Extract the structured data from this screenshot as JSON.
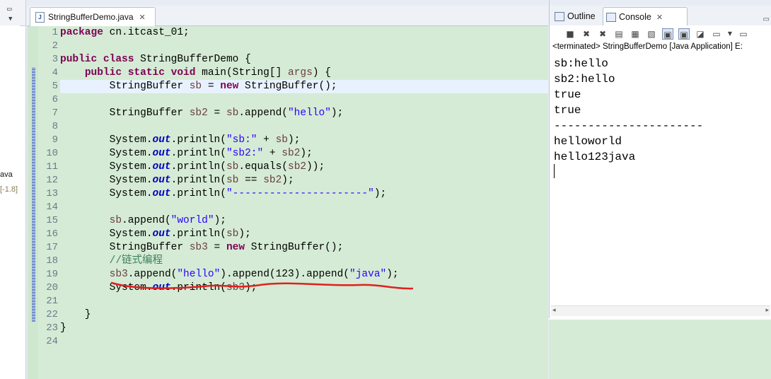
{
  "editor": {
    "tab_title": "StringBufferDemo.java",
    "lines": [
      {
        "n": "1",
        "segs": [
          {
            "t": "package",
            "c": "kw"
          },
          {
            "t": " cn.itcast_01;",
            "c": ""
          }
        ]
      },
      {
        "n": "2",
        "segs": []
      },
      {
        "n": "3",
        "segs": [
          {
            "t": "public",
            "c": "kw"
          },
          {
            "t": " ",
            "c": ""
          },
          {
            "t": "class",
            "c": "kw"
          },
          {
            "t": " StringBufferDemo {",
            "c": ""
          }
        ]
      },
      {
        "n": "4",
        "segs": [
          {
            "t": "    ",
            "c": ""
          },
          {
            "t": "public",
            "c": "kw"
          },
          {
            "t": " ",
            "c": ""
          },
          {
            "t": "static",
            "c": "kw"
          },
          {
            "t": " ",
            "c": ""
          },
          {
            "t": "void",
            "c": "kw"
          },
          {
            "t": " main(String[] ",
            "c": ""
          },
          {
            "t": "args",
            "c": "var"
          },
          {
            "t": ") {",
            "c": ""
          }
        ]
      },
      {
        "n": "5",
        "segs": [
          {
            "t": "        StringBuffer ",
            "c": ""
          },
          {
            "t": "sb",
            "c": "var"
          },
          {
            "t": " = ",
            "c": ""
          },
          {
            "t": "new",
            "c": "kw"
          },
          {
            "t": " StringBuffer();",
            "c": ""
          }
        ]
      },
      {
        "n": "6",
        "segs": []
      },
      {
        "n": "7",
        "segs": [
          {
            "t": "        StringBuffer ",
            "c": ""
          },
          {
            "t": "sb2",
            "c": "var"
          },
          {
            "t": " = ",
            "c": ""
          },
          {
            "t": "sb",
            "c": "var"
          },
          {
            "t": ".append(",
            "c": ""
          },
          {
            "t": "\"hello\"",
            "c": "str"
          },
          {
            "t": ");",
            "c": ""
          }
        ]
      },
      {
        "n": "8",
        "segs": []
      },
      {
        "n": "9",
        "segs": [
          {
            "t": "        System.",
            "c": ""
          },
          {
            "t": "out",
            "c": "fld"
          },
          {
            "t": ".println(",
            "c": ""
          },
          {
            "t": "\"sb:\"",
            "c": "str"
          },
          {
            "t": " + ",
            "c": ""
          },
          {
            "t": "sb",
            "c": "var"
          },
          {
            "t": ");",
            "c": ""
          }
        ]
      },
      {
        "n": "10",
        "segs": [
          {
            "t": "        System.",
            "c": ""
          },
          {
            "t": "out",
            "c": "fld"
          },
          {
            "t": ".println(",
            "c": ""
          },
          {
            "t": "\"sb2:\"",
            "c": "str"
          },
          {
            "t": " + ",
            "c": ""
          },
          {
            "t": "sb2",
            "c": "var"
          },
          {
            "t": ");",
            "c": ""
          }
        ]
      },
      {
        "n": "11",
        "segs": [
          {
            "t": "        System.",
            "c": ""
          },
          {
            "t": "out",
            "c": "fld"
          },
          {
            "t": ".println(",
            "c": ""
          },
          {
            "t": "sb",
            "c": "var"
          },
          {
            "t": ".equals(",
            "c": ""
          },
          {
            "t": "sb2",
            "c": "var"
          },
          {
            "t": "));",
            "c": ""
          }
        ]
      },
      {
        "n": "12",
        "segs": [
          {
            "t": "        System.",
            "c": ""
          },
          {
            "t": "out",
            "c": "fld"
          },
          {
            "t": ".println(",
            "c": ""
          },
          {
            "t": "sb",
            "c": "var"
          },
          {
            "t": " == ",
            "c": ""
          },
          {
            "t": "sb2",
            "c": "var"
          },
          {
            "t": ");",
            "c": ""
          }
        ]
      },
      {
        "n": "13",
        "segs": [
          {
            "t": "        System.",
            "c": ""
          },
          {
            "t": "out",
            "c": "fld"
          },
          {
            "t": ".println(",
            "c": ""
          },
          {
            "t": "\"----------------------\"",
            "c": "str"
          },
          {
            "t": ");",
            "c": ""
          }
        ]
      },
      {
        "n": "14",
        "segs": []
      },
      {
        "n": "15",
        "segs": [
          {
            "t": "        ",
            "c": ""
          },
          {
            "t": "sb",
            "c": "var"
          },
          {
            "t": ".append(",
            "c": ""
          },
          {
            "t": "\"world\"",
            "c": "str"
          },
          {
            "t": ");",
            "c": ""
          }
        ]
      },
      {
        "n": "16",
        "segs": [
          {
            "t": "        System.",
            "c": ""
          },
          {
            "t": "out",
            "c": "fld"
          },
          {
            "t": ".println(",
            "c": ""
          },
          {
            "t": "sb",
            "c": "var"
          },
          {
            "t": ");",
            "c": ""
          }
        ]
      },
      {
        "n": "17",
        "segs": [
          {
            "t": "        StringBuffer ",
            "c": ""
          },
          {
            "t": "sb3",
            "c": "var"
          },
          {
            "t": " = ",
            "c": ""
          },
          {
            "t": "new",
            "c": "kw"
          },
          {
            "t": " StringBuffer();",
            "c": ""
          }
        ]
      },
      {
        "n": "18",
        "segs": [
          {
            "t": "        ",
            "c": ""
          },
          {
            "t": "//链式编程",
            "c": "cmt"
          }
        ]
      },
      {
        "n": "19",
        "segs": [
          {
            "t": "        ",
            "c": ""
          },
          {
            "t": "sb3",
            "c": "var"
          },
          {
            "t": ".append(",
            "c": ""
          },
          {
            "t": "\"hello\"",
            "c": "str"
          },
          {
            "t": ").append(123).append(",
            "c": ""
          },
          {
            "t": "\"java\"",
            "c": "str"
          },
          {
            "t": ");",
            "c": ""
          }
        ]
      },
      {
        "n": "20",
        "segs": [
          {
            "t": "        System.",
            "c": ""
          },
          {
            "t": "out",
            "c": "fld"
          },
          {
            "t": ".println(",
            "c": ""
          },
          {
            "t": "sb3",
            "c": "var"
          },
          {
            "t": ");",
            "c": ""
          }
        ]
      },
      {
        "n": "21",
        "segs": []
      },
      {
        "n": "22",
        "segs": [
          {
            "t": "    }",
            "c": ""
          }
        ]
      },
      {
        "n": "23",
        "segs": [
          {
            "t": "}",
            "c": ""
          }
        ]
      },
      {
        "n": "24",
        "segs": []
      }
    ]
  },
  "left": {
    "label_ava": "ava",
    "label_jre": "[-1.8]"
  },
  "right": {
    "tab_outline": "Outline",
    "tab_console": "Console",
    "console_header": "<terminated> StringBufferDemo [Java Application] E:",
    "console_lines": [
      "sb:hello",
      "sb2:hello",
      "true",
      "true",
      "----------------------",
      "helloworld",
      "hello123java"
    ]
  },
  "colors": {
    "editor_bg": "#d5ebd5",
    "keyword": "#7f0055",
    "string": "#2a00ff",
    "field": "#0000c0",
    "comment": "#3f7f5f",
    "annotation_red": "#e02020"
  }
}
